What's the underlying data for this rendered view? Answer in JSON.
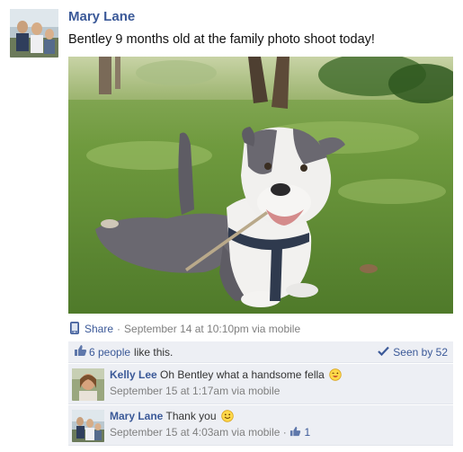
{
  "post": {
    "author": "Mary Lane",
    "text": "Bentley 9 months old at the family photo shoot today!",
    "photo_icon": "dog-photo",
    "share_label": "Share",
    "separator": "·",
    "timestamp": "September 14 at 10:10pm via mobile"
  },
  "likes": {
    "count_label": "6 people",
    "suffix": "like this.",
    "seen_label": "Seen by 52"
  },
  "comments": [
    {
      "author": "Kelly Lee",
      "text": "Oh Bentley what a handsome fella",
      "emoji": "wink-face-emoji",
      "time": "September 15 at 1:17am via mobile"
    },
    {
      "author": "Mary Lane",
      "text": "Thank you",
      "emoji": "smile-face-emoji",
      "time": "September 15 at 4:03am via mobile",
      "separator": "·",
      "like_count": "1"
    }
  ],
  "colors": {
    "link": "#3b5998",
    "muted": "#7f7f7f",
    "ufi_bg": "#edeff4"
  }
}
